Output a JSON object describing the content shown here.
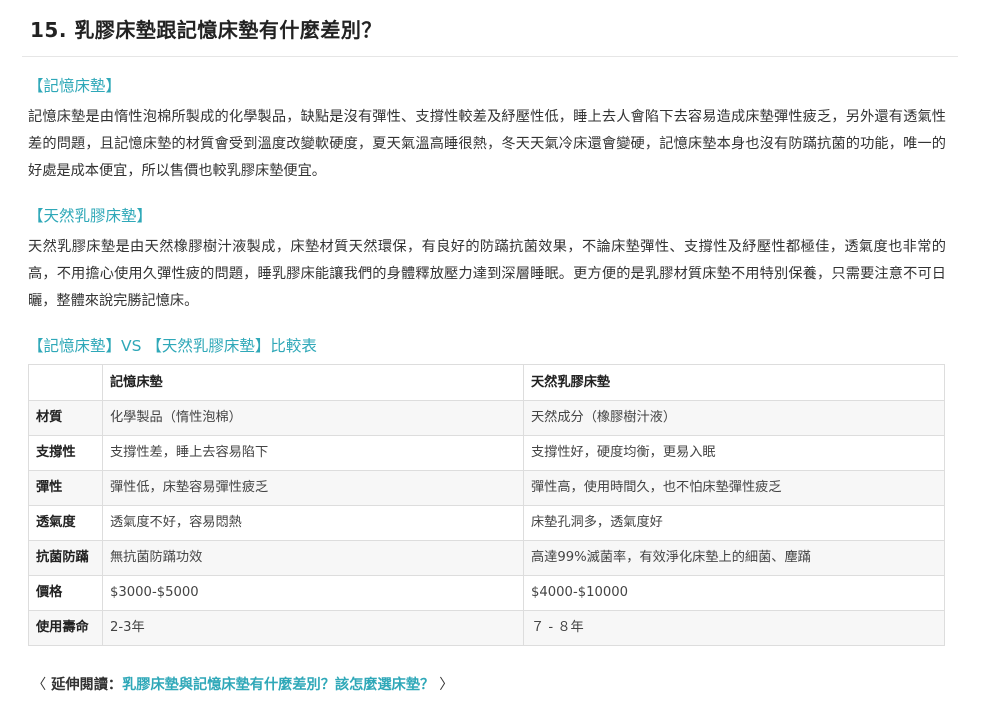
{
  "title": "15. 乳膠床墊跟記憶床墊有什麼差別？",
  "sections": [
    {
      "heading": "【記憶床墊】",
      "body": "記憶床墊是由惰性泡棉所製成的化學製品，缺點是沒有彈性、支撐性較差及紓壓性低，睡上去人會陷下去容易造成床墊彈性疲乏，另外還有透氣性差的問題，且記憶床墊的材質會受到溫度改變軟硬度，夏天氣溫高睡很熱，冬天天氣冷床還會變硬，記憶床墊本身也沒有防蹣抗菌的功能，唯一的好處是成本便宜，所以售價也較乳膠床墊便宜。"
    },
    {
      "heading": "【天然乳膠床墊】",
      "body": "天然乳膠床墊是由天然橡膠樹汁液製成，床墊材質天然環保，有良好的防蹣抗菌效果，不論床墊彈性、支撐性及紓壓性都極佳，透氣度也非常的高，不用擔心使用久彈性疲的問題，睡乳膠床能讓我們的身體釋放壓力達到深層睡眠。更方便的是乳膠材質床墊不用特別保養，只需要注意不可日曬，整體來說完勝記憶床。"
    }
  ],
  "comparison": {
    "heading": "【記憶床墊】VS 【天然乳膠床墊】比較表",
    "headers": [
      "",
      "記憶床墊",
      "天然乳膠床墊"
    ],
    "rows": [
      {
        "label": "材質",
        "memory": "化學製品（惰性泡棉）",
        "latex": "天然成分（橡膠樹汁液）"
      },
      {
        "label": "支撐性",
        "memory": "支撐性差，睡上去容易陷下",
        "latex": "支撐性好，硬度均衡，更易入眠"
      },
      {
        "label": "彈性",
        "memory": "彈性低，床墊容易彈性疲乏",
        "latex": "彈性高，使用時間久，也不怕床墊彈性疲乏"
      },
      {
        "label": "透氣度",
        "memory": "透氣度不好，容易悶熱",
        "latex": "床墊孔洞多，透氣度好"
      },
      {
        "label": "抗菌防蹣",
        "memory": "無抗菌防蹣功效",
        "latex": "高達99%滅菌率，有效淨化床墊上的細菌、塵蹣"
      },
      {
        "label": "價格",
        "memory": "$3000-$5000",
        "latex": "$4000-$10000"
      },
      {
        "label": "使用壽命",
        "memory": "2-3年",
        "latex": "７ - ８年"
      }
    ]
  },
  "further_reading": {
    "open_bracket": "〈",
    "prefix": "延伸閱讀：",
    "link_text": "乳膠床墊與記憶床墊有什麼差別？該怎麼選床墊？",
    "close_bracket": "〉"
  },
  "colors": {
    "accent": "#2fa8b8",
    "text": "#333333",
    "border": "#dddddd",
    "row_stripe": "#f7f7f7"
  }
}
